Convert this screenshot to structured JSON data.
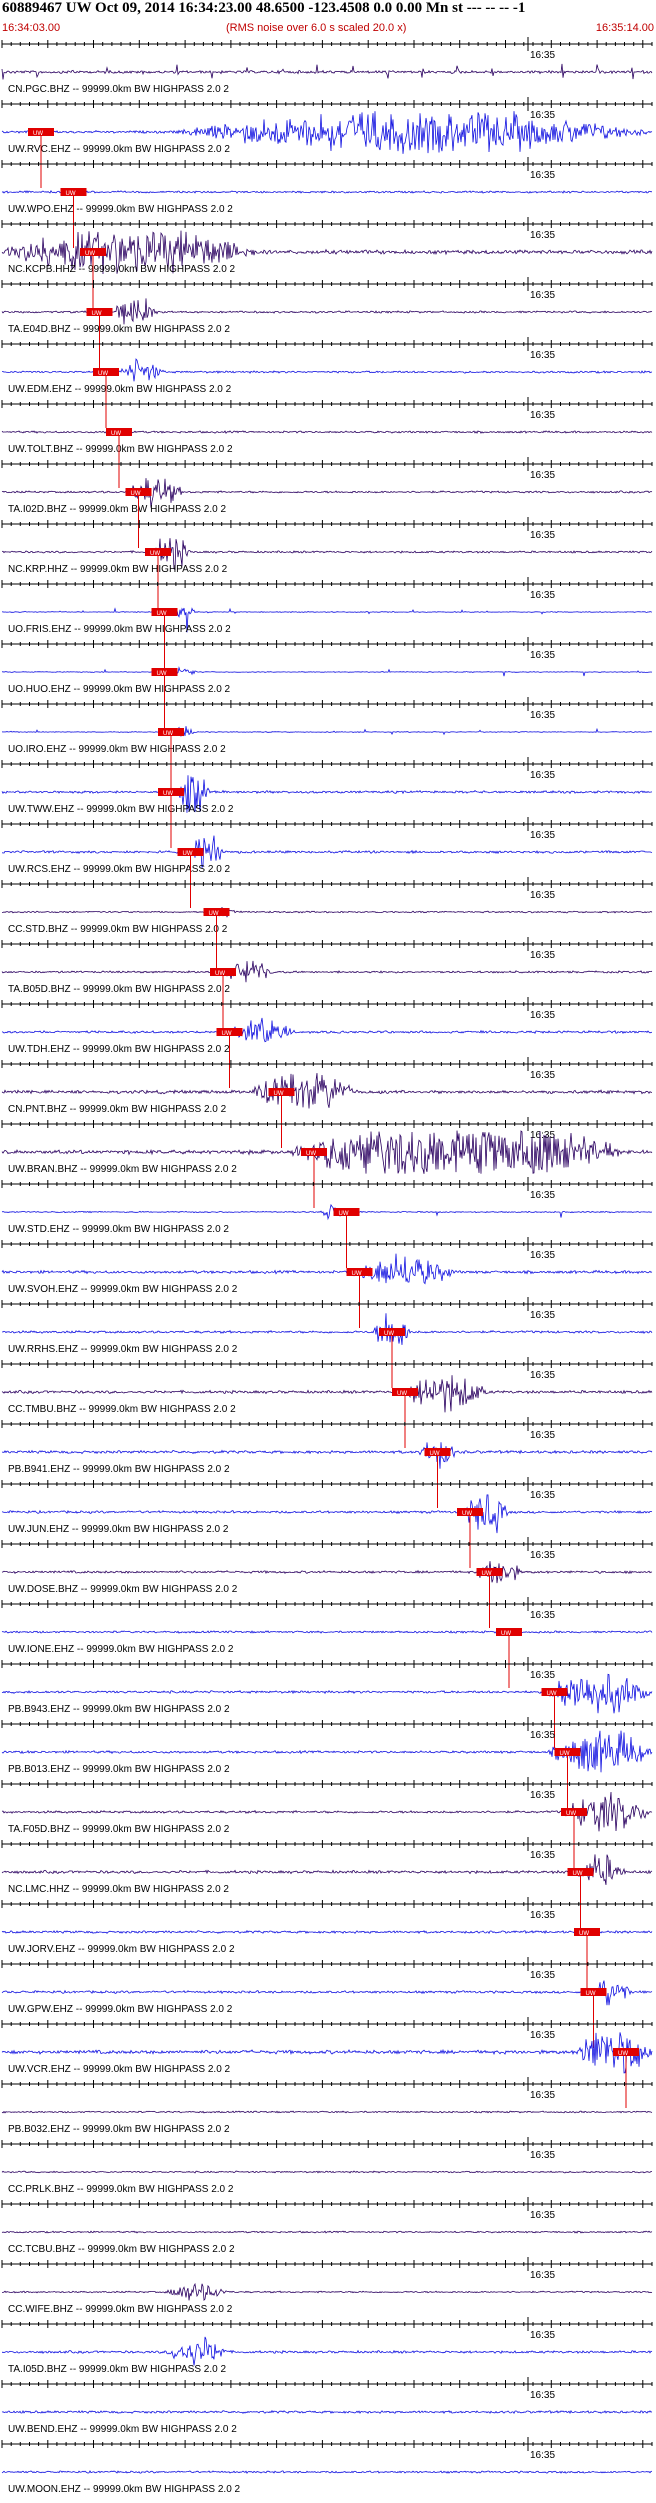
{
  "header": {
    "title": "60889467 UW Oct 09, 2014 16:34:23.00   48.6500 -123.4508  0.0 0.00 Mn st --- -- --  -1",
    "start_time": "16:34:03.00",
    "note": "(RMS noise over 6.0 s scaled 20.0 x)",
    "end_time": "16:35:14.00"
  },
  "colors": {
    "trace_dark": "#2a0060",
    "trace_blue": "#1010e0",
    "pick": "#e00000",
    "header_red": "#c00000",
    "axis": "#000000"
  },
  "chart_data": {
    "type": "seismogram",
    "time_start": "16:34:03.00",
    "time_end": "16:35:14.00",
    "tick_label": "16:35",
    "pick_label": "UW",
    "channels": [
      {
        "label": "CN.PGC.BHZ -- 99999.0km BW  HIGHPASS  2.0  2",
        "color": "trace_dark",
        "amp": 0.35,
        "burst": null,
        "pick": null,
        "periodic": true
      },
      {
        "label": "UW.RVC.EHZ -- 99999.0km BW  HIGHPASS  2.0  2",
        "color": "trace_blue",
        "amp": 0.3,
        "burst": [
          0.26,
          1.0,
          2.2
        ],
        "pick": 0.06
      },
      {
        "label": "UW.WPO.EHZ -- 99999.0km BW  HIGHPASS  2.0  2",
        "color": "trace_blue",
        "amp": 0.25,
        "burst": null,
        "pick": 0.11
      },
      {
        "label": "NC.KCPB.HHZ -- 99999.0km BW  HIGHPASS  2.0  2",
        "color": "trace_dark",
        "amp": 0.5,
        "burst": [
          0.0,
          0.4,
          1.6
        ],
        "pick": 0.14
      },
      {
        "label": "TA.E04D.BHZ -- 99999.0km BW  HIGHPASS  2.0  2",
        "color": "trace_dark",
        "amp": 0.25,
        "burst": [
          0.17,
          0.24,
          2.0
        ],
        "pick": 0.15
      },
      {
        "label": "UW.EDM.EHZ -- 99999.0km BW  HIGHPASS  2.0  2",
        "color": "trace_blue",
        "amp": 0.25,
        "burst": [
          0.18,
          0.25,
          1.5
        ],
        "pick": 0.16
      },
      {
        "label": "UW.TOLT.BHZ -- 99999.0km BW  HIGHPASS  2.0  2",
        "color": "trace_dark",
        "amp": 0.25,
        "burst": null,
        "pick": 0.18
      },
      {
        "label": "TA.I02D.BHZ -- 99999.0km BW  HIGHPASS  2.0  2",
        "color": "trace_dark",
        "amp": 0.25,
        "burst": [
          0.19,
          0.28,
          2.0
        ],
        "pick": 0.21
      },
      {
        "label": "NC.KRP.HHZ -- 99999.0km BW  HIGHPASS  2.0  2",
        "color": "trace_dark",
        "amp": 0.25,
        "burst": [
          0.23,
          0.29,
          2.2
        ],
        "pick": 0.24
      },
      {
        "label": "UO.FRIS.EHZ -- 99999.0km BW  HIGHPASS  2.0  2",
        "color": "trace_blue",
        "amp": 0.1,
        "burst": [
          0.26,
          0.3,
          2.2
        ],
        "pick": 0.25,
        "spikes": true
      },
      {
        "label": "UO.HUO.EHZ -- 99999.0km BW  HIGHPASS  2.0  2",
        "color": "trace_blue",
        "amp": 0.1,
        "burst": [
          0.26,
          0.3,
          1.8
        ],
        "pick": 0.25,
        "spikes": true
      },
      {
        "label": "UO.IRO.EHZ -- 99999.0km BW  HIGHPASS  2.0  2",
        "color": "trace_blue",
        "amp": 0.1,
        "burst": [
          0.26,
          0.3,
          1.8
        ],
        "pick": 0.26,
        "spikes": true
      },
      {
        "label": "UW.TWW.EHZ -- 99999.0km BW  HIGHPASS  2.0  2",
        "color": "trace_blue",
        "amp": 0.3,
        "burst": [
          0.27,
          0.32,
          2.5
        ],
        "pick": 0.26
      },
      {
        "label": "UW.RCS.EHZ -- 99999.0km BW  HIGHPASS  2.0  2",
        "color": "trace_blue",
        "amp": 0.3,
        "burst": [
          0.29,
          0.34,
          2.2
        ],
        "pick": 0.29
      },
      {
        "label": "CC.STD.BHZ -- 99999.0km BW  HIGHPASS  2.0  2",
        "color": "trace_dark",
        "amp": 0.2,
        "burst": [
          0.32,
          0.36,
          1.2
        ],
        "pick": 0.33
      },
      {
        "label": "TA.B05D.BHZ -- 99999.0km BW  HIGHPASS  2.0  2",
        "color": "trace_dark",
        "amp": 0.25,
        "burst": [
          0.34,
          0.42,
          1.5
        ],
        "pick": 0.34
      },
      {
        "label": "UW.TDH.EHZ -- 99999.0km BW  HIGHPASS  2.0  2",
        "color": "trace_blue",
        "amp": 0.3,
        "burst": [
          0.35,
          0.45,
          1.5
        ],
        "pick": 0.35
      },
      {
        "label": "CN.PNT.BHZ -- 99999.0km BW  HIGHPASS  2.0  2",
        "color": "trace_dark",
        "amp": 0.4,
        "burst": [
          0.38,
          0.55,
          1.6
        ],
        "pick": 0.43
      },
      {
        "label": "UW.BRAN.BHZ -- 99999.0km BW  HIGHPASS  2.0  2",
        "color": "trace_dark",
        "amp": 0.5,
        "burst": [
          0.44,
          0.96,
          2.6
        ],
        "pick": 0.48
      },
      {
        "label": "UW.STD.EHZ -- 99999.0km BW  HIGHPASS  2.0  2",
        "color": "trace_blue",
        "amp": 0.15,
        "burst": [
          0.49,
          0.53,
          1.6
        ],
        "pick": 0.53,
        "spikes": true
      },
      {
        "label": "UW.SVOH.EHZ -- 99999.0km BW  HIGHPASS  2.0  2",
        "color": "trace_blue",
        "amp": 0.35,
        "burst": [
          0.53,
          0.7,
          1.5
        ],
        "pick": 0.55
      },
      {
        "label": "UW.RRHS.EHZ -- 99999.0km BW  HIGHPASS  2.0  2",
        "color": "trace_blue",
        "amp": 0.3,
        "burst": [
          0.57,
          0.63,
          2.4
        ],
        "pick": 0.6
      },
      {
        "label": "CC.TMBU.BHZ -- 99999.0km BW  HIGHPASS  2.0  2",
        "color": "trace_dark",
        "amp": 0.35,
        "burst": [
          0.61,
          0.75,
          1.7
        ],
        "pick": 0.62
      },
      {
        "label": "PB.B941.EHZ -- 99999.0km BW  HIGHPASS  2.0  2",
        "color": "trace_blue",
        "amp": 0.35,
        "burst": [
          0.64,
          0.7,
          1.4
        ],
        "pick": 0.67
      },
      {
        "label": "UW.JUN.EHZ -- 99999.0km BW  HIGHPASS  2.0  2",
        "color": "trace_blue",
        "amp": 0.3,
        "burst": [
          0.71,
          0.78,
          2.5
        ],
        "pick": 0.72
      },
      {
        "label": "UW.DOSE.BHZ -- 99999.0km BW  HIGHPASS  2.0  2",
        "color": "trace_dark",
        "amp": 0.3,
        "burst": [
          0.73,
          0.8,
          1.6
        ],
        "pick": 0.75
      },
      {
        "label": "UW.IONE.EHZ -- 99999.0km BW  HIGHPASS  2.0  2",
        "color": "trace_blue",
        "amp": 0.25,
        "burst": null,
        "pick": 0.78
      },
      {
        "label": "PB.B943.EHZ -- 99999.0km BW  HIGHPASS  2.0  2",
        "color": "trace_blue",
        "amp": 0.3,
        "burst": [
          0.83,
          1.0,
          2.6
        ],
        "pick": 0.85
      },
      {
        "label": "PB.B013.EHZ -- 99999.0km BW  HIGHPASS  2.0  2",
        "color": "trace_blue",
        "amp": 0.3,
        "burst": [
          0.84,
          1.0,
          2.6
        ],
        "pick": 0.87
      },
      {
        "label": "TA.F05D.BHZ -- 99999.0km BW  HIGHPASS  2.0  2",
        "color": "trace_dark",
        "amp": 0.3,
        "burst": [
          0.86,
          1.0,
          2.2
        ],
        "pick": 0.88
      },
      {
        "label": "NC.LMC.HHZ -- 99999.0km BW  HIGHPASS  2.0  2",
        "color": "trace_dark",
        "amp": 0.35,
        "burst": [
          0.88,
          0.96,
          1.5
        ],
        "pick": 0.89
      },
      {
        "label": "UW.JORV.EHZ -- 99999.0km BW  HIGHPASS  2.0  2",
        "color": "trace_blue",
        "amp": 0.3,
        "burst": null,
        "pick": 0.9
      },
      {
        "label": "UW.GPW.EHZ -- 99999.0km BW  HIGHPASS  2.0  2",
        "color": "trace_blue",
        "amp": 0.3,
        "burst": [
          0.9,
          0.97,
          1.6
        ],
        "pick": 0.91
      },
      {
        "label": "UW.VCR.EHZ -- 99999.0km BW  HIGHPASS  2.0  2",
        "color": "trace_blue",
        "amp": 0.45,
        "burst": [
          0.88,
          1.0,
          2.4
        ],
        "pick": 0.96
      },
      {
        "label": "PB.B032.EHZ -- 99999.0km BW  HIGHPASS  2.0  2",
        "color": "trace_dark",
        "amp": 0.2,
        "burst": null,
        "pick": null
      },
      {
        "label": "CC.PRLK.BHZ -- 99999.0km BW  HIGHPASS  2.0  2",
        "color": "trace_dark",
        "amp": 0.2,
        "burst": null,
        "pick": null
      },
      {
        "label": "CC.TCBU.BHZ -- 99999.0km BW  HIGHPASS  2.0  2",
        "color": "trace_dark",
        "amp": 0.2,
        "burst": null,
        "pick": null
      },
      {
        "label": "CC.WIFE.BHZ -- 99999.0km BW  HIGHPASS  2.0  2",
        "color": "trace_dark",
        "amp": 0.2,
        "burst": [
          0.25,
          0.35,
          1.4
        ],
        "pick": null
      },
      {
        "label": "TA.I05D.BHZ -- 99999.0km BW  HIGHPASS  2.0  2",
        "color": "trace_blue",
        "amp": 0.3,
        "burst": [
          0.25,
          0.35,
          1.6
        ],
        "pick": null
      },
      {
        "label": "UW.BEND.EHZ -- 99999.0km BW  HIGHPASS  2.0  2",
        "color": "trace_blue",
        "amp": 0.3,
        "burst": null,
        "pick": null
      },
      {
        "label": "UW.MOON.EHZ -- 99999.0km BW  HIGHPASS  2.0  2",
        "color": "trace_blue",
        "amp": 0.25,
        "burst": null,
        "pick": null
      }
    ]
  }
}
